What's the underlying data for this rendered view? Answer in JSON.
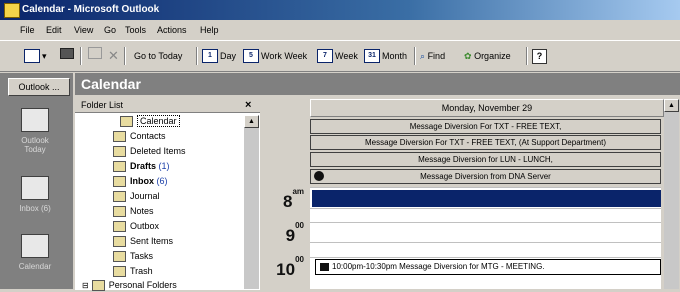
{
  "window": {
    "title": "Calendar - Microsoft Outlook"
  },
  "menu": [
    "File",
    "Edit",
    "View",
    "Go",
    "Tools",
    "Actions",
    "Help"
  ],
  "toolbar": {
    "go_to_today": "Go to Today",
    "day": "Day",
    "day_icon": "1",
    "work_week": "Work Week",
    "work_week_icon": "5",
    "week": "Week",
    "week_icon": "7",
    "month": "Month",
    "month_icon": "31",
    "find": "Find",
    "organize": "Organize"
  },
  "outlook_bar": {
    "header": "Outlook ...",
    "shortcuts": [
      "Outlook Today",
      "Inbox (6)",
      "Calendar"
    ]
  },
  "main_header": "Calendar",
  "folder_list": {
    "title": "Folder List",
    "close": "×",
    "items": [
      {
        "label": "Calendar",
        "count": ""
      },
      {
        "label": "Contacts",
        "count": ""
      },
      {
        "label": "Deleted Items",
        "count": ""
      },
      {
        "label": "Drafts",
        "count": "(1)"
      },
      {
        "label": "Inbox",
        "count": "(6)"
      },
      {
        "label": "Journal",
        "count": ""
      },
      {
        "label": "Notes",
        "count": ""
      },
      {
        "label": "Outbox",
        "count": ""
      },
      {
        "label": "Sent Items",
        "count": ""
      },
      {
        "label": "Tasks",
        "count": ""
      },
      {
        "label": "Trash",
        "count": ""
      },
      {
        "label": "Personal Folders",
        "count": ""
      }
    ]
  },
  "day_view": {
    "date_header": "Monday, November 29",
    "all_day_events": [
      "Message Diversion For TXT - FREE TEXT,",
      "Message Diversion For TXT - FREE TEXT, (At Support Department)",
      "Message Diversion for LUN - LUNCH,",
      "Message Diversion from DNA Server"
    ],
    "hours": [
      {
        "h": "8",
        "m": "am"
      },
      {
        "h": "9",
        "m": "00"
      },
      {
        "h": "10",
        "m": "00"
      }
    ],
    "appointment": "10:00pm-10:30pm Message Diversion for MTG - MEETING."
  },
  "colors": {
    "accent": "#0a246a",
    "title_end": "#a6caf0",
    "panel_gray": "#808080"
  }
}
